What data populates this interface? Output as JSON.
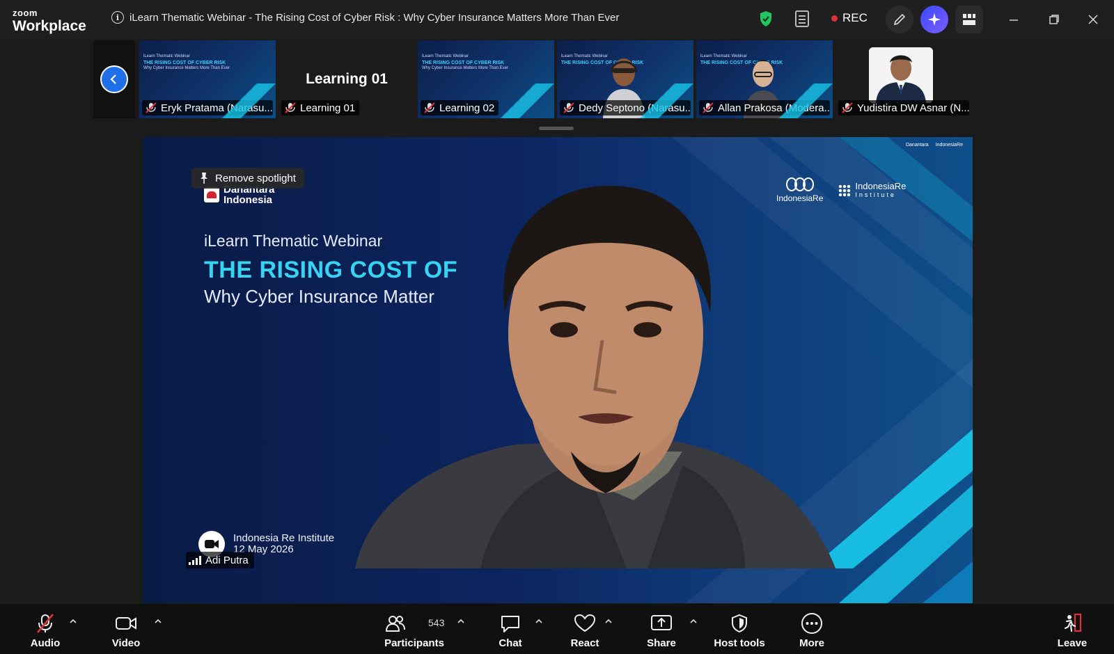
{
  "app": {
    "brand_top": "zoom",
    "brand_bottom": "Workplace"
  },
  "meeting": {
    "title": "iLearn Thematic Webinar - The Rising Cost of Cyber Risk : Why Cyber Insurance Matters More Than Ever"
  },
  "status": {
    "rec_label": "REC"
  },
  "gallery": {
    "tiles": [
      {
        "name": "Eryk Pratama (Narasu...",
        "kind": "slide"
      },
      {
        "name": "Learning 01",
        "kind": "name",
        "display": "Learning 01"
      },
      {
        "name": "Learning 02",
        "kind": "slide"
      },
      {
        "name": "Dedy Septono (Narasu...",
        "kind": "video"
      },
      {
        "name": "Allan Prakosa (Modera...",
        "kind": "video"
      },
      {
        "name": "Yudistira DW Asnar (N...",
        "kind": "photo"
      }
    ],
    "slide_mini": {
      "line1": "iLearn Thematic Webinar",
      "line2": "THE RISING COST OF CYBER RISK",
      "line3": "Why Cyber Insurance Matters More Than Ever"
    }
  },
  "main": {
    "spotlight_label": "Remove spotlight",
    "org_logo": [
      "Danantara",
      "Indonesia"
    ],
    "logo_ir": "IndonesiaRe",
    "logo_iri_top": "IndonesiaRe",
    "logo_iri_bottom": "Institute",
    "subtitle": "iLearn Thematic Webinar",
    "title": "THE RISING COST OF",
    "tagline": "Why Cyber Insurance Matter",
    "footer_org": "Indonesia Re Institute",
    "footer_date": "12 May 2026",
    "speaker_name": "Adi Putra"
  },
  "toolbar": {
    "audio": "Audio",
    "video": "Video",
    "participants": "Participants",
    "participants_count": "543",
    "chat": "Chat",
    "react": "React",
    "share": "Share",
    "host_tools": "Host tools",
    "more": "More",
    "leave": "Leave"
  },
  "colors": {
    "accent_blue": "#1e6fe8",
    "rec_red": "#e0323b",
    "slide_cyan": "#37d3f2",
    "shield_green": "#22c55e"
  }
}
